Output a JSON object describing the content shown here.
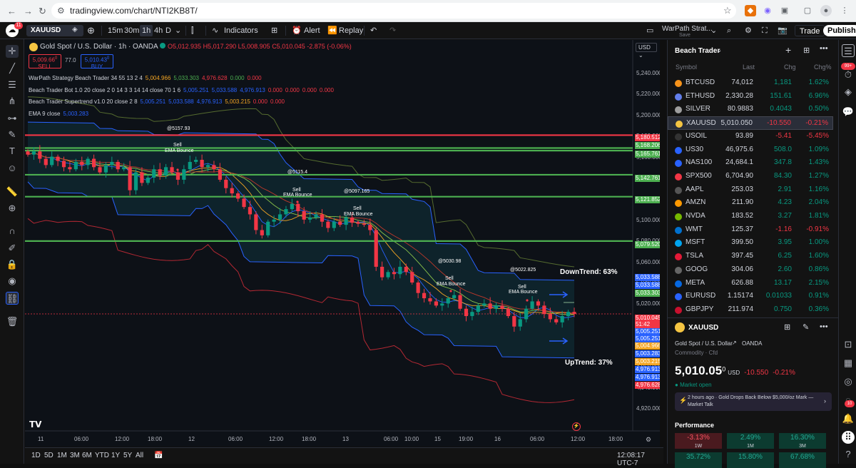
{
  "browser": {
    "url": "tradingview.com/chart/NTI2KB8T/"
  },
  "toolbar": {
    "symbol": "XAUUSD",
    "intervals": [
      "15m",
      "30m",
      "1h",
      "4h",
      "D"
    ],
    "indicators": "Indicators",
    "alert": "Alert",
    "replay": "Replay",
    "strategy_name": "WarPath Strat...",
    "strategy_sub": "Save",
    "trade": "Trade",
    "publish": "Publish",
    "notif_count": "11"
  },
  "chart": {
    "title": "Gold Spot / U.S. Dollar · 1h · OANDA",
    "ohlc": {
      "o": "O5,012.935",
      "h": "H5,017.290",
      "l": "L5,008.905",
      "c": "C5,010.045",
      "chg": "-2.875 (-0.06%)"
    },
    "sell_price": "5,009.66",
    "sell_sup": "0",
    "sell_label": "SELL",
    "spread": "77.0",
    "buy_price": "5,010.43",
    "buy_sup": "0",
    "buy_label": "BUY",
    "currency": "USD",
    "indicators": [
      {
        "name": "WarPath Strategy Beach Trader 34 55 13 2 4",
        "values": [
          {
            "v": "5,004.966",
            "c": "#f5a623"
          },
          {
            "v": "5,033.303",
            "c": "#4caf50"
          },
          {
            "v": "4,976.628",
            "c": "#f23645"
          },
          {
            "v": "0.000",
            "c": "#4caf50"
          },
          {
            "v": "0.000",
            "c": "#f23645"
          }
        ]
      },
      {
        "name": "Beach Trader Bot 1.0 20 close 2 0 14 3 3 14 14 close 70 1 6",
        "values": [
          {
            "v": "5,005.251",
            "c": "#2962ff"
          },
          {
            "v": "5,033.588",
            "c": "#2962ff"
          },
          {
            "v": "4,976.913",
            "c": "#2962ff"
          },
          {
            "v": "0.000",
            "c": "#f23645"
          },
          {
            "v": "0.000",
            "c": "#f23645"
          },
          {
            "v": "0.000",
            "c": "#f23645"
          },
          {
            "v": "0.000",
            "c": "#f23645"
          }
        ]
      },
      {
        "name": "Beach Trader Supertrend v1.0 20 close 2 8",
        "values": [
          {
            "v": "5,005.251",
            "c": "#2962ff"
          },
          {
            "v": "5,033.588",
            "c": "#2962ff"
          },
          {
            "v": "4,976.913",
            "c": "#2962ff"
          },
          {
            "v": "5,003.215",
            "c": "#f5a623"
          },
          {
            "v": "0.000",
            "c": "#f23645"
          },
          {
            "v": "0.000",
            "c": "#f23645"
          }
        ]
      },
      {
        "name": "EMA 9 close",
        "values": [
          {
            "v": "5,003.283",
            "c": "#2962ff"
          }
        ]
      }
    ],
    "price_ticks": [
      "5,240.000",
      "5,220.000",
      "5,200.000",
      "5,180.000",
      "5,160.000",
      "5,140.000",
      "5,120.000",
      "5,100.000",
      "5,080.000",
      "5,060.000",
      "5,040.000",
      "5,020.000",
      "5,000.000",
      "4,980.000",
      "4,960.000",
      "4,940.000",
      "4,920.000"
    ],
    "hlines": [
      {
        "label": "5,180.512",
        "color": "#f23645"
      },
      {
        "label": "5,168.206",
        "color": "#4caf50"
      },
      {
        "label": "5,165.761",
        "color": "#4caf50"
      },
      {
        "label": "5,142.761",
        "color": "#4caf50"
      },
      {
        "label": "5,121.852",
        "color": "#4caf50"
      },
      {
        "label": "5,079.520",
        "color": "#4caf50"
      }
    ],
    "price_labels": [
      {
        "label": "5,033.588",
        "color": "#2962ff"
      },
      {
        "label": "5,033.588",
        "color": "#2962ff"
      },
      {
        "label": "5,033.303",
        "color": "#4caf50"
      },
      {
        "label": "5,010.045",
        "color": "#f23645"
      },
      {
        "label": "51:42",
        "color": "#f23645"
      },
      {
        "label": "5,005.251",
        "color": "#2962ff"
      },
      {
        "label": "5,005.251",
        "color": "#2962ff"
      },
      {
        "label": "5,004.966",
        "color": "#f5a623"
      },
      {
        "label": "5,003.283",
        "color": "#2962ff"
      },
      {
        "label": "5,003.215",
        "color": "#f5a623"
      },
      {
        "label": "4,976.913",
        "color": "#2962ff"
      },
      {
        "label": "4,976.913",
        "color": "#2962ff"
      },
      {
        "label": "4,976.628",
        "color": "#f23645"
      }
    ],
    "annotations": {
      "peaks": [
        "@5157.93",
        "@5115.4",
        "@5097.165",
        "@5030.98",
        "@5022.825"
      ],
      "sell": "Sell",
      "ema": "EMA Bounce",
      "downtrend": "DownTrend: 63%",
      "uptrend": "UpTrend: 37%"
    },
    "x_ticks": [
      "11",
      "06:00",
      "12:00",
      "18:00",
      "12",
      "06:00",
      "12:00",
      "18:00",
      "13",
      "06:00",
      "10:00",
      "15",
      "19:00",
      "16",
      "06:00",
      "12:00",
      "18:00"
    ]
  },
  "bottombar": {
    "ranges": [
      "1D",
      "5D",
      "1M",
      "3M",
      "6M",
      "YTD",
      "1Y",
      "5Y",
      "All"
    ],
    "time": "12:08:17 UTC-7"
  },
  "watchlist": {
    "title": "Beach Trader",
    "headers": [
      "Symbol",
      "Last",
      "Chg",
      "Chg%"
    ],
    "rows": [
      {
        "sym": "BTCUSD",
        "last": "74,012",
        "chg": "1,181",
        "pct": "1.62%",
        "up": true,
        "icon": "#f7931a"
      },
      {
        "sym": "ETHUSD",
        "last": "2,330.28",
        "chg": "151.61",
        "pct": "6.96%",
        "up": true,
        "icon": "#627eea"
      },
      {
        "sym": "SILVER",
        "last": "80.9883",
        "chg": "0.4043",
        "pct": "0.50%",
        "up": true,
        "icon": "#9e9e9e"
      },
      {
        "sym": "XAUUSD",
        "last": "5,010.050",
        "chg": "-10.550",
        "pct": "-0.21%",
        "up": false,
        "icon": "#f5c542"
      },
      {
        "sym": "USOIL",
        "last": "93.89",
        "chg": "-5.41",
        "pct": "-5.45%",
        "up": false,
        "icon": "#333333"
      },
      {
        "sym": "US30",
        "last": "46,975.6",
        "chg": "508.0",
        "pct": "1.09%",
        "up": true,
        "icon": "#2962ff"
      },
      {
        "sym": "NAS100",
        "last": "24,684.1",
        "chg": "347.8",
        "pct": "1.43%",
        "up": true,
        "icon": "#2962ff"
      },
      {
        "sym": "SPX500",
        "last": "6,704.90",
        "chg": "84.30",
        "pct": "1.27%",
        "up": true,
        "icon": "#f23645"
      },
      {
        "sym": "AAPL",
        "last": "253.03",
        "chg": "2.91",
        "pct": "1.16%",
        "up": true,
        "icon": "#555555"
      },
      {
        "sym": "AMZN",
        "last": "211.90",
        "chg": "4.23",
        "pct": "2.04%",
        "up": true,
        "icon": "#ff9900"
      },
      {
        "sym": "NVDA",
        "last": "183.52",
        "chg": "3.27",
        "pct": "1.81%",
        "up": true,
        "icon": "#76b900"
      },
      {
        "sym": "WMT",
        "last": "125.37",
        "chg": "-1.16",
        "pct": "-0.91%",
        "up": false,
        "icon": "#0071ce"
      },
      {
        "sym": "MSFT",
        "last": "399.50",
        "chg": "3.95",
        "pct": "1.00%",
        "up": true,
        "icon": "#00a4ef"
      },
      {
        "sym": "TSLA",
        "last": "397.45",
        "chg": "6.25",
        "pct": "1.60%",
        "up": true,
        "icon": "#e31937"
      },
      {
        "sym": "GOOG",
        "last": "304.06",
        "chg": "2.60",
        "pct": "0.86%",
        "up": true,
        "icon": "#666666"
      },
      {
        "sym": "META",
        "last": "626.88",
        "chg": "13.17",
        "pct": "2.15%",
        "up": true,
        "icon": "#0668e1"
      },
      {
        "sym": "EURUSD",
        "last": "1.15174",
        "chg": "0.01033",
        "pct": "0.91%",
        "up": true,
        "icon": "#2962ff"
      },
      {
        "sym": "GBPJPY",
        "last": "211.974",
        "chg": "0.750",
        "pct": "0.36%",
        "up": true,
        "icon": "#c8102e"
      }
    ]
  },
  "detail": {
    "symbol": "XAUUSD",
    "name": "Gold Spot / U.S. Dollar",
    "exchange": "OANDA",
    "category": "Commodity · Cfd",
    "price": "5,010.05",
    "price_sup": "0",
    "currency": "USD",
    "chg": "-10.550",
    "pct": "-0.21%",
    "status": "Market open",
    "news": "2 hours ago · Gold Drops Back Below $5,000/oz Mark — Market Talk",
    "perf_title": "Performance",
    "perf": [
      {
        "v": "-3.13%",
        "p": "1W",
        "up": false
      },
      {
        "v": "2.49%",
        "p": "1M",
        "up": true
      },
      {
        "v": "16.30%",
        "p": "3M",
        "up": true
      },
      {
        "v": "35.72%",
        "p": "",
        "up": true
      },
      {
        "v": "15.80%",
        "p": "",
        "up": true
      },
      {
        "v": "67.68%",
        "p": "",
        "up": true
      }
    ]
  },
  "rightbar": {
    "badge1": "99+",
    "badge2": "10"
  }
}
